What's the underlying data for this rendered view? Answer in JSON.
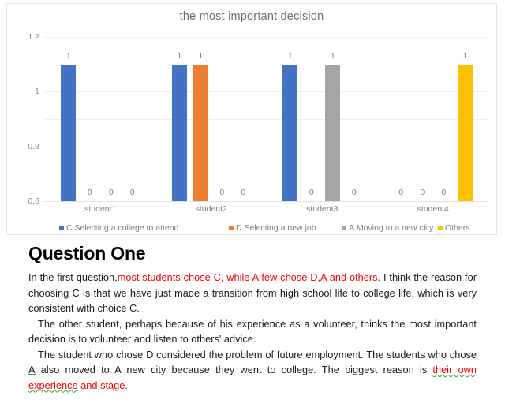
{
  "chart_data": {
    "type": "bar",
    "title": "the most important decision",
    "xlabel": "",
    "ylabel": "",
    "ylim": [
      0,
      1.2
    ],
    "yticks": [
      "0",
      "0.2",
      "0.4",
      "0.6",
      "0.8",
      "1",
      "1.2"
    ],
    "ytick_values": [
      0,
      0.2,
      0.4,
      0.6,
      0.8,
      1,
      1.2
    ],
    "grid": true,
    "legend_position": "bottom",
    "categories": [
      "student1",
      "student2",
      "student3",
      "student4"
    ],
    "series": [
      {
        "name": "C.Selecting a college to attend",
        "color": "#4472c4",
        "values": [
          1,
          1,
          1,
          0
        ],
        "labels": [
          "1",
          "1",
          "1",
          "0"
        ]
      },
      {
        "name": "D.Selecting a new job",
        "color": "#ed7d31",
        "values": [
          0,
          1,
          0,
          0
        ],
        "labels": [
          "0",
          "1",
          "0",
          "0"
        ]
      },
      {
        "name": "A.Moving to a new ciity",
        "color": "#a5a5a5",
        "values": [
          0,
          0,
          1,
          0
        ],
        "labels": [
          "0",
          "0",
          "1",
          "0"
        ]
      },
      {
        "name": "Others",
        "color": "#ffc000",
        "values": [
          0,
          0,
          0,
          1
        ],
        "labels": [
          "0",
          "0",
          "0",
          "1"
        ]
      }
    ]
  },
  "document": {
    "heading": "Question One",
    "paragraphs": [
      {
        "id": "p1",
        "runs": [
          {
            "text": "In the first ",
            "style": "plain"
          },
          {
            "text": "question,",
            "style": "underline-red"
          },
          {
            "text": "most students chose C, while A few chose D,A and others.",
            "style": "red-underline"
          },
          {
            "text": " I think the reason for choosing C is that we have just made a transition from high school life to college life, which is very consistent with choice C.",
            "style": "plain"
          }
        ]
      },
      {
        "id": "p2",
        "runs": [
          {
            "text": "The other student, perhaps because of his experience as a volunteer, thinks the most important decision is to volunteer and listen to others' advice.",
            "style": "plain"
          }
        ]
      },
      {
        "id": "p3",
        "runs": [
          {
            "text": "The student who chose D considered the problem of future employment. The students who chose ",
            "style": "plain"
          },
          {
            "text": "A",
            "style": "green-solid"
          },
          {
            "text": " also moved to A new city because they went to college. The biggest reason is ",
            "style": "plain"
          },
          {
            "text": "their own experience",
            "style": "red-green-wavy"
          },
          {
            "text": " and stage.",
            "style": "red"
          }
        ]
      }
    ]
  }
}
